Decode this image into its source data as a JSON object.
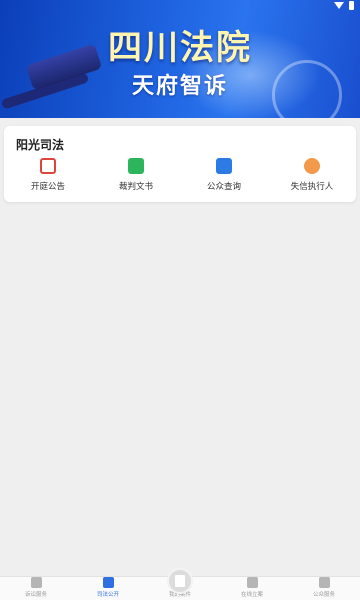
{
  "banner": {
    "title": "四川法院",
    "subtitle": "天府智诉"
  },
  "sunshine": {
    "title": "阳光司法",
    "items": [
      {
        "label": "开庭公告",
        "icon": "court-notice-icon",
        "color": "#e0443e"
      },
      {
        "label": "裁判文书",
        "icon": "judgment-document-icon",
        "color": "#2db55d"
      },
      {
        "label": "公众查询",
        "icon": "public-search-icon",
        "color": "#2c7be5"
      },
      {
        "label": "失信执行人",
        "icon": "dishonest-debtor-icon",
        "color": "#f2994a"
      }
    ]
  },
  "nav": {
    "items": [
      {
        "label": "诉讼服务",
        "icon": "gavel-icon",
        "active": false
      },
      {
        "label": "司法公开",
        "icon": "news-icon",
        "active": true
      },
      {
        "label": "我的案件",
        "icon": "case-file-icon",
        "active": false
      },
      {
        "label": "在线立案",
        "icon": "file-icon",
        "active": false
      },
      {
        "label": "公众服务",
        "icon": "box-icon",
        "active": false
      }
    ],
    "active_color": "#2f6fe0"
  }
}
